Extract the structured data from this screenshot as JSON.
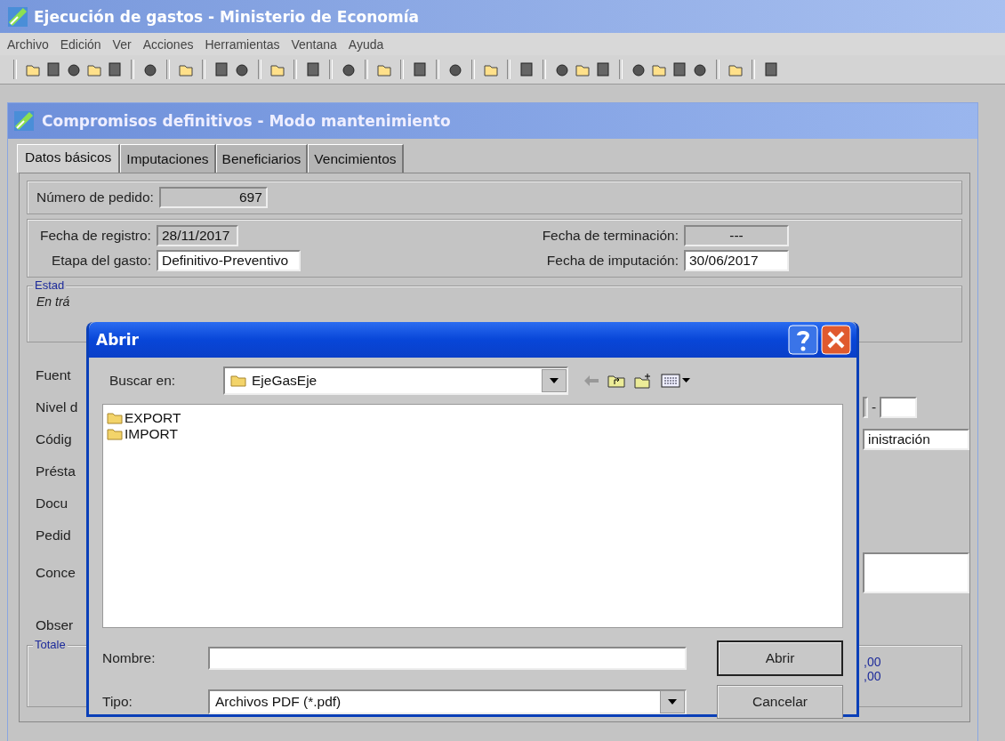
{
  "window": {
    "title": "Ejecución de gastos - Ministerio de Economía"
  },
  "menu": [
    "Archivo",
    "Edición",
    "Ver",
    "Acciones",
    "Herramientas",
    "Ventana",
    "Ayuda"
  ],
  "child_window": {
    "title": "Compromisos definitivos - Modo mantenimiento",
    "tabs": [
      {
        "label": "Datos básicos",
        "selected": true
      },
      {
        "label": "Imputaciones",
        "selected": false
      },
      {
        "label": "Beneficiarios",
        "selected": false
      },
      {
        "label": "Vencimientos",
        "selected": false
      }
    ],
    "pedido": {
      "label": "Número de pedido:",
      "value": "697"
    },
    "fechas": [
      {
        "label": "Fecha de registro:",
        "value": "28/11/2017",
        "editable": false
      },
      {
        "label": "Etapa del gasto:",
        "value": "Definitivo-Preventivo",
        "editable": true
      },
      {
        "label": "Fecha de terminación:",
        "value": "---",
        "editable": false
      },
      {
        "label": "Fecha de imputación:",
        "value": "30/06/2017",
        "editable": true
      }
    ],
    "estado": {
      "legend": "Estad",
      "value": "En trá"
    },
    "rows": [
      {
        "label": "Fuent",
        "kind": "none"
      },
      {
        "label": "Nivel d",
        "kind": "pair",
        "separator": "-"
      },
      {
        "label": "Códig",
        "kind": "field",
        "value": "inistración"
      },
      {
        "label": "Présta",
        "kind": "none"
      },
      {
        "label": "Docu",
        "kind": "none"
      },
      {
        "label": "Pedid",
        "kind": "none"
      },
      {
        "label": "Conce",
        "kind": "memo"
      },
      {
        "label": "Obser",
        "kind": "none"
      }
    ],
    "totales": {
      "legend": "Totale",
      "values": [
        ",00",
        ",00"
      ]
    }
  },
  "dialog": {
    "title": "Abrir",
    "look_in": {
      "label": "Buscar en:",
      "value": "EjeGasEje"
    },
    "files": [
      {
        "name": "EXPORT"
      },
      {
        "name": "IMPORT"
      }
    ],
    "name_field": {
      "label": "Nombre:"
    },
    "type_field": {
      "label": "Tipo:",
      "value": "Archivos PDF (*.pdf)"
    },
    "buttons": [
      {
        "label": "Abrir",
        "default": true
      },
      {
        "label": "Cancelar",
        "default": false
      }
    ]
  }
}
